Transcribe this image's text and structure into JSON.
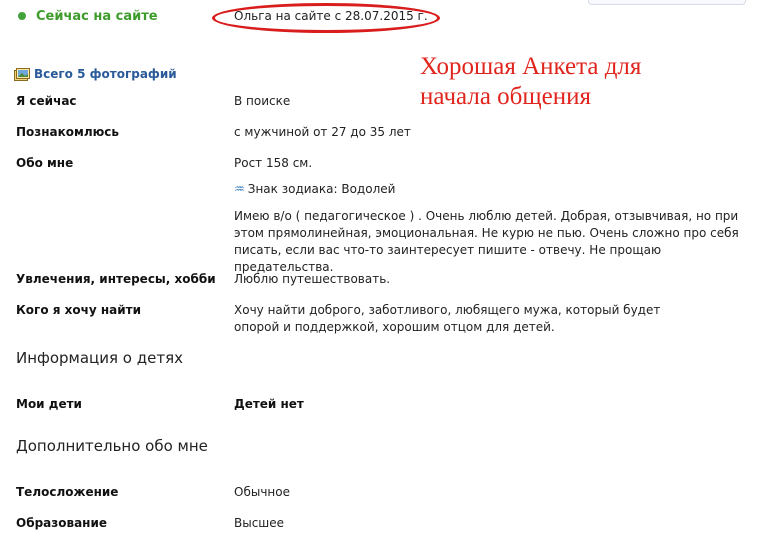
{
  "status": {
    "online_label": "Сейчас на сайте",
    "member_since": "Ольга на сайте с 28.07.2015 г."
  },
  "photos": {
    "link_label": "Всего 5 фотографий"
  },
  "annotation": {
    "line1": "Хорошая Анкета для",
    "line2": "начала общения"
  },
  "profile": {
    "now_label": "Я сейчас",
    "now_value": "В поиске",
    "meet_label": "Познакомлюсь",
    "meet_value": "с мужчиной от 27 до 35 лет",
    "about_label": "Обо мне",
    "about_height": "Рост 158 см.",
    "about_zodiac": "Знак зодиака: Водолей",
    "about_text": "Имею в/о ( педагогическое ) . Очень люблю детей. Добрая, отзывчивая, но при этом прямолинейная, эмоциональная. Не курю не пью. Очень сложно про себя писать, если вас что-то заинтересует пишите - отвечу. Не прощаю предательства.",
    "hobby_label": "Увлечения, интересы, хобби",
    "hobby_value": "Люблю путешествовать.",
    "seek_label": "Кого я хочу найти",
    "seek_value": "Хочу найти доброго, заботливого, любящего мужа, который будет опорой и поддержкой, хорошим отцом для детей."
  },
  "children": {
    "section_title": "Информация о детях",
    "my_kids_label": "Мои дети",
    "my_kids_value": "Детей нет"
  },
  "extra": {
    "section_title": "Дополнительно обо мне",
    "build_label": "Телосложение",
    "build_value": "Обычное",
    "edu_label": "Образование",
    "edu_value": "Высшее"
  },
  "colors": {
    "online": "#41a33a",
    "link": "#2a5a9a",
    "annotation": "#e0251d"
  }
}
